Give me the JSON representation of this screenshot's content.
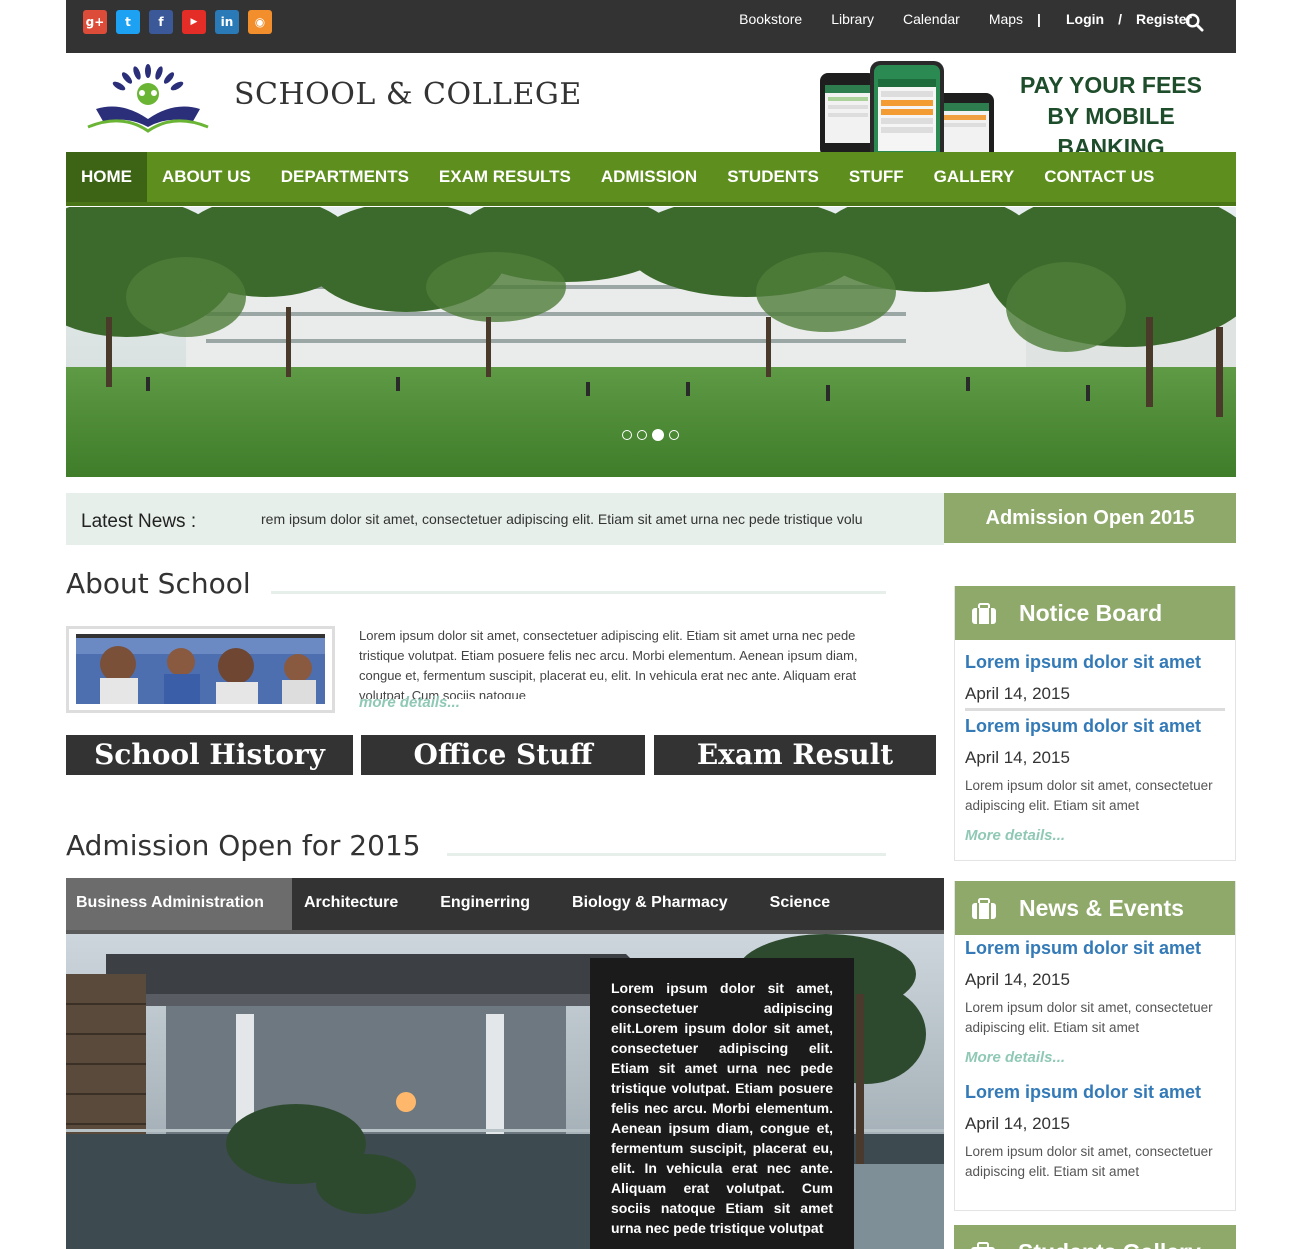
{
  "topbar": {
    "social": [
      {
        "name": "google-plus-icon",
        "glyph": "g+",
        "color": "#dd4b39"
      },
      {
        "name": "twitter-icon",
        "glyph": "t",
        "color": "#1da1f2"
      },
      {
        "name": "facebook-icon",
        "glyph": "f",
        "color": "#3b5998"
      },
      {
        "name": "youtube-icon",
        "glyph": "▶",
        "color": "#e52d27"
      },
      {
        "name": "linkedin-icon",
        "glyph": "in",
        "color": "#2a7ab8"
      },
      {
        "name": "rss-icon",
        "glyph": "◉",
        "color": "#f28e2b"
      }
    ],
    "links": [
      "Bookstore",
      "Library",
      "Calendar",
      "Maps"
    ],
    "separator": "|",
    "login": "Login",
    "slash": "/",
    "register": "Register"
  },
  "header": {
    "title": "SCHOOL & COLLEGE",
    "fees_line1": "PAY YOUR FEES",
    "fees_line2": "BY MOBILE BANKING"
  },
  "nav": [
    "HOME",
    "ABOUT US",
    "DEPARTMENTS",
    "EXAM RESULTS",
    "ADMISSION",
    "STUDENTS",
    "STUFF",
    "GALLERY",
    "CONTACT US"
  ],
  "slider": {
    "dots": 4,
    "active_dot": 3
  },
  "news": {
    "label": "Latest News :",
    "ticker": "rem ipsum dolor sit amet, consectetuer adipiscing elit. Etiam sit amet urna nec pede tristique volu",
    "admission_button": "Admission Open 2015"
  },
  "about": {
    "title": "About School",
    "text": "Lorem ipsum dolor sit amet, consectetuer adipiscing elit. Etiam sit amet urna nec pede tristique volutpat. Etiam posuere felis nec arcu. Morbi elementum. Aenean ipsum diam, congue et, fermentum suscipit, placerat eu, elit. In vehicula erat nec ante. Aliquam erat volutpat. Cum sociis natoque",
    "more": "more details..."
  },
  "tiles": [
    "School History",
    "Office Stuff",
    "Exam Result"
  ],
  "admission": {
    "title": "Admission Open for 2015",
    "tabs": [
      "Business Administration",
      "Architecture",
      "Enginerring",
      "Biology & Pharmacy",
      "Science"
    ],
    "active_tab": 0,
    "overlay_text": "Lorem ipsum dolor sit amet, consectetuer adipiscing elit.Lorem ipsum dolor sit amet, consectetuer adipiscing elit. Etiam sit amet urna nec pede tristique volutpat. Etiam posuere felis nec arcu. Morbi elementum. Aenean ipsum diam, congue et, fermentum suscipit, placerat eu, elit. In vehicula erat nec ante. Aliquam erat volutpat. Cum sociis natoque Etiam sit amet urna nec pede tristique volutpat"
  },
  "notice_board": {
    "title": "Notice Board",
    "items": [
      {
        "title": "Lorem ipsum dolor sit amet",
        "date": "April 14, 2015"
      },
      {
        "title": "Lorem ipsum dolor sit amet",
        "date": "April 14, 2015",
        "text": "Lorem ipsum dolor sit amet, consectetuer adipiscing elit. Etiam sit amet",
        "more": "More details..."
      }
    ]
  },
  "news_events": {
    "title": "News & Events",
    "items": [
      {
        "title": "Lorem ipsum dolor sit amet",
        "date": "April 14, 2015",
        "text": "Lorem ipsum dolor sit amet, consectetuer adipiscing elit. Etiam sit amet",
        "more": "More details..."
      },
      {
        "title": "Lorem ipsum dolor sit amet",
        "date": "April 14, 2015",
        "text": "Lorem ipsum dolor sit amet, consectetuer adipiscing elit. Etiam sit amet"
      }
    ]
  },
  "students_gallery": {
    "title": "Students Gallery"
  },
  "colors": {
    "nav": "#5e8e1e",
    "nav_active": "#3d6415",
    "accent": "#8fa96a",
    "link": "#337ab7",
    "more": "#8fc9b5",
    "dark": "#333333"
  }
}
